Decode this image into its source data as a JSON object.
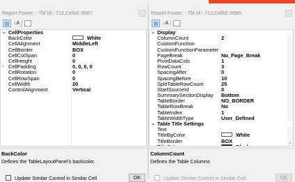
{
  "left": {
    "title": "Report Footer: - Tbl Id:- 712,CellId:-9087",
    "grid": {
      "categories": [
        {
          "label": "CellProperties",
          "rows": [
            {
              "name": "BackColor",
              "value": "White",
              "swatch": "white"
            },
            {
              "name": "CellAlignment",
              "value": "MiddleLeft"
            },
            {
              "name": "CellBorder",
              "value": "BOX"
            },
            {
              "name": "CellColSpan",
              "value": "0"
            },
            {
              "name": "CellHeight",
              "value": "0"
            },
            {
              "name": "CellPadding",
              "value": "0, 0, 0, 0",
              "expandable": true
            },
            {
              "name": "CellRotation",
              "value": "0"
            },
            {
              "name": "CellRowSpan",
              "value": "0"
            },
            {
              "name": "CellWidth",
              "value": "20"
            },
            {
              "name": "ControlAlignment",
              "value": "Vertical"
            }
          ]
        }
      ]
    },
    "description": {
      "title": "BackColor",
      "text": "Defines the TableLayoutPanel's backcolor."
    },
    "footer": {
      "checkbox_label": "Update Similar Control in Similar Cell",
      "ok_label": "OK"
    }
  },
  "right": {
    "title": "Report Footer: - Tbl Id:- 712,CellId:-9086",
    "grid": {
      "categories": [
        {
          "label": "Display",
          "rows": [
            {
              "name": "ColumnCount",
              "value": "2"
            },
            {
              "name": "CustomFunction",
              "value": ""
            },
            {
              "name": "CustomFunctionParameter",
              "value": ""
            },
            {
              "name": "PageBreak",
              "value": "No_Page_Break"
            },
            {
              "name": "PivotDataCols",
              "value": "1"
            },
            {
              "name": "RowCount",
              "value": "3"
            },
            {
              "name": "SpacingAfter",
              "value": "0"
            },
            {
              "name": "SpacingBefore",
              "value": "10"
            },
            {
              "name": "SplitTableRowCount",
              "value": "25"
            },
            {
              "name": "StartSourceId",
              "value": "0"
            },
            {
              "name": "SummarySectionDisplay",
              "value": "Bottom"
            },
            {
              "name": "TableBorder",
              "value": "NO_BORDER"
            },
            {
              "name": "TableRowBreak",
              "value": "No"
            },
            {
              "name": "TableIndex",
              "value": "1"
            },
            {
              "name": "TableWidthType",
              "value": "User_Defined"
            }
          ]
        },
        {
          "label": "Table Title Settings",
          "rows": [
            {
              "name": "Text",
              "value": ""
            },
            {
              "name": "TitleBgColor",
              "value": "White",
              "swatch": "white"
            },
            {
              "name": "TitleBorder",
              "value": "BOX"
            },
            {
              "name": "TitleColor",
              "value": "Black",
              "swatch": "black"
            }
          ]
        }
      ]
    },
    "description": {
      "title": "ColumnCount",
      "text": "Defines the Table Columns"
    },
    "footer": {
      "checkbox_label": "Update Similar Control in Similar Cell",
      "ok_label": "OK"
    }
  },
  "icons": {
    "categorized": "categorized-view-icon",
    "alphabetical": "alphabetical-sort-icon",
    "property_pages": "property-pages-icon",
    "expanded": "chevron-down-icon",
    "collapsed": "chevron-right-icon"
  },
  "colors": {
    "accent_bar": "#e8452a",
    "toolbar_active": "#cde4f7"
  }
}
